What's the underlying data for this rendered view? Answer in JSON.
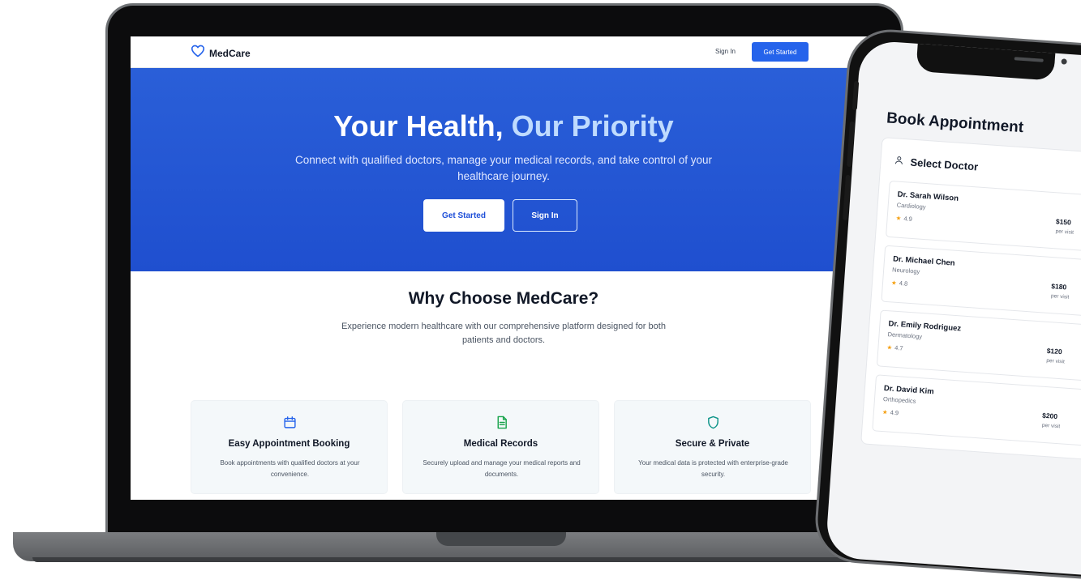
{
  "navbar": {
    "brand": "MedCare",
    "sign_in": "Sign In",
    "get_started": "Get Started"
  },
  "hero": {
    "title_main": "Your Health,",
    "title_accent": "Our Priority",
    "subtitle": "Connect with qualified doctors, manage your medical records, and take control of your healthcare journey.",
    "primary_button": "Get Started",
    "secondary_button": "Sign In"
  },
  "why": {
    "title": "Why Choose MedCare?",
    "subtitle": "Experience modern healthcare with our comprehensive platform designed for both patients and doctors."
  },
  "features": [
    {
      "icon": "calendar-icon",
      "title": "Easy Appointment Booking",
      "description": "Book appointments with qualified doctors at your convenience."
    },
    {
      "icon": "document-icon",
      "title": "Medical Records",
      "description": "Securely upload and manage your medical reports and documents."
    },
    {
      "icon": "shield-icon",
      "title": "Secure & Private",
      "description": "Your medical data is protected with enterprise-grade security."
    }
  ],
  "phone": {
    "title": "Book Appointment",
    "section_title": "Select Doctor",
    "doctors": [
      {
        "name": "Dr. Sarah Wilson",
        "specialty": "Cardiology",
        "rating": "4.9",
        "price": "$150",
        "per": "per visit"
      },
      {
        "name": "Dr. Michael Chen",
        "specialty": "Neurology",
        "rating": "4.8",
        "price": "$180",
        "per": "per visit"
      },
      {
        "name": "Dr. Emily Rodriguez",
        "specialty": "Dermatology",
        "rating": "4.7",
        "price": "$120",
        "per": "per visit"
      },
      {
        "name": "Dr. David Kim",
        "specialty": "Orthopedics",
        "rating": "4.9",
        "price": "$200",
        "per": "per visit"
      }
    ]
  },
  "colors": {
    "brand_blue": "#2563eb",
    "hero_accent": "#bfdbfe",
    "record_green": "#16a34a",
    "shield_teal": "#0d9488",
    "star": "#f59e0b"
  }
}
